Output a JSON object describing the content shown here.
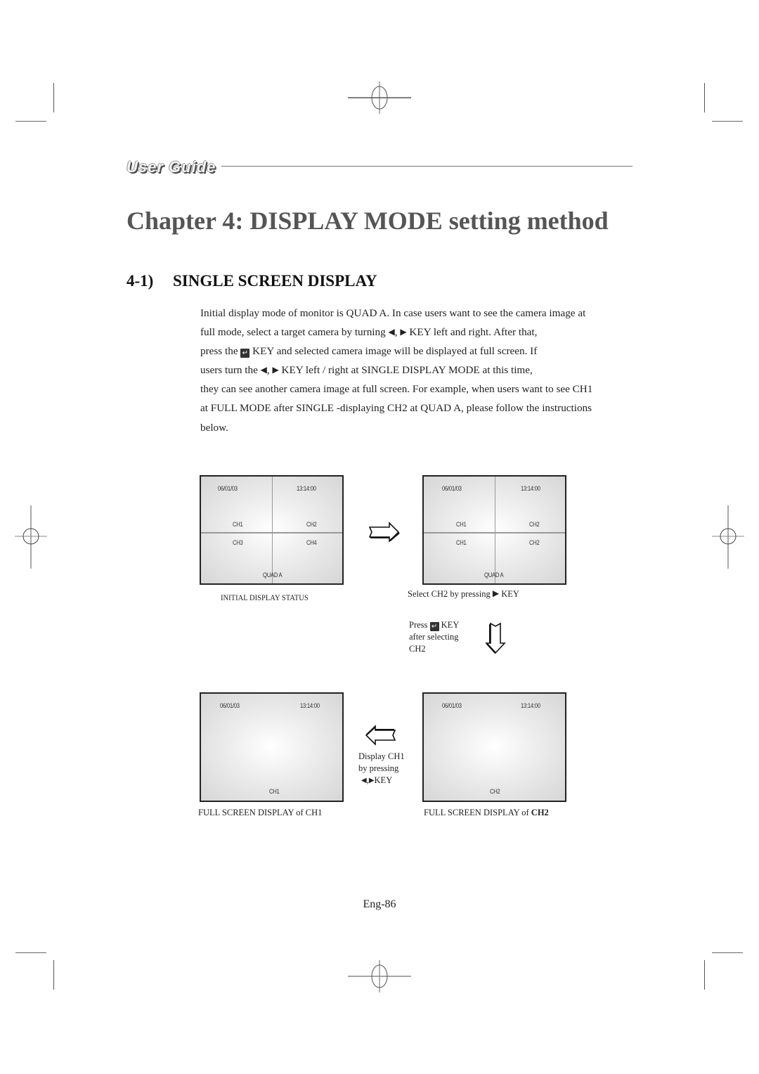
{
  "header": {
    "brand_label": "User Guide"
  },
  "chapter": {
    "title": "Chapter 4: DISPLAY MODE setting method"
  },
  "section": {
    "number": "4-1)",
    "title": "SINGLE SCREEN DISPLAY"
  },
  "body": {
    "line1": "Initial display mode of monitor is QUAD A. In case users want to see the camera image at",
    "line2_pre": "full mode, select a target camera by turning ",
    "line2_post": " KEY left and right. After that,",
    "line3_pre": "press the ",
    "line3_post": " KEY and selected camera image will be displayed at full screen. If",
    "line4_pre": "users turn the ",
    "line4_post": "  KEY left / right at SINGLE DISPLAY MODE at this time,",
    "line5": "they can see another camera image at full screen. For example, when users want to see CH1",
    "line6": "at FULL MODE after SINGLE -displaying CH2 at QUAD A, please follow the instructions",
    "line7": "below."
  },
  "icons": {
    "left_key": "◀",
    "right_key": "▶",
    "comma": ",",
    "enter_key": "↵"
  },
  "diagram": {
    "panel1": {
      "date": "06/01/03",
      "time": "13:14:00",
      "quadrants": [
        "CH1",
        "CH2",
        "CH3",
        "CH4"
      ],
      "mode": "QUAD A",
      "caption": "INITIAL DISPLAY STATUS"
    },
    "panel2": {
      "date": "06/01/03",
      "time": "13:14:00",
      "quadrants": [
        "CH1",
        "CH2",
        "CH1",
        "CH2"
      ],
      "mode": "QUAD A",
      "caption_pre": "Select CH2 by pressing ",
      "caption_post": " KEY"
    },
    "step_note": {
      "line1_pre": "Press ",
      "line1_post": " KEY",
      "line2": "after selecting",
      "line3": "CH2"
    },
    "panel3": {
      "date": "06/01/03",
      "time": "13:14:00",
      "channel": "CH2",
      "caption_pre": "FULL SCREEN DISPLAY of ",
      "caption_bold": "CH2"
    },
    "back_note": {
      "line1": "Display CH1",
      "line2": "by pressing",
      "line3": "KEY"
    },
    "panel4": {
      "date": "06/01/03",
      "time": "13:14:00",
      "channel": "CH1",
      "caption": "FULL SCREEN DISPLAY of CH1"
    }
  },
  "footer": {
    "page_number": "Eng-86"
  }
}
